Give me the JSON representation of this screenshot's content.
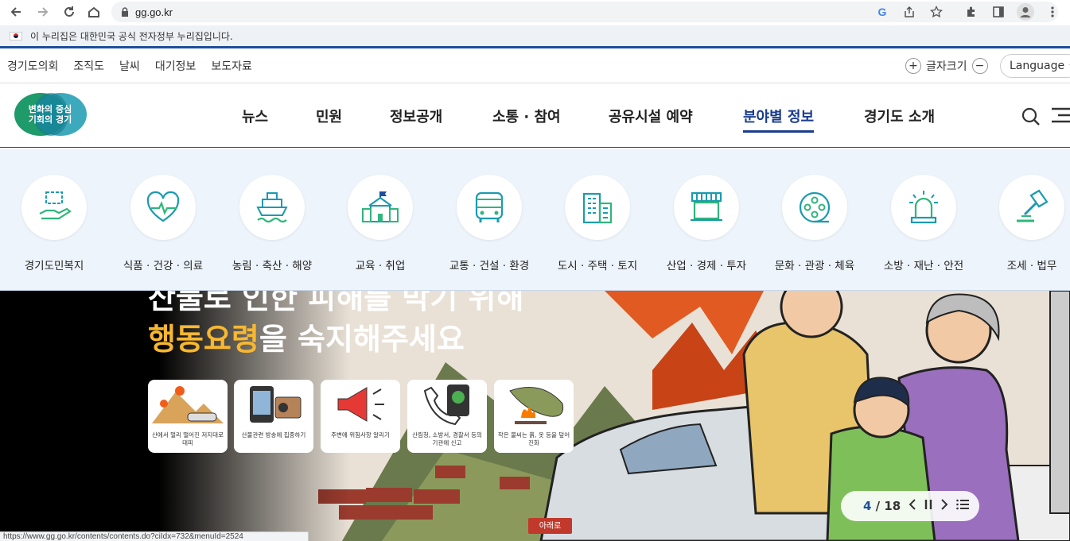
{
  "browser": {
    "url": "gg.go.kr",
    "icons": [
      "back-icon",
      "forward-icon",
      "reload-icon",
      "home-icon",
      "lock-icon",
      "google-icon",
      "share-icon",
      "star-icon",
      "extension-icon",
      "sidebar-icon",
      "profile-icon",
      "more-icon"
    ]
  },
  "gov_banner": {
    "text": "이 누리집은 대한민국 공식 전자정부 누리집입니다."
  },
  "util": {
    "links": [
      "경기도의회",
      "조직도",
      "날씨",
      "대기정보",
      "보도자료"
    ],
    "font_size_label": "글자크기",
    "plus": "+",
    "minus": "−",
    "language": "Language"
  },
  "header": {
    "logo_line1": "변화의 중심",
    "logo_line2": "기회의 경기",
    "gnb": [
      "뉴스",
      "민원",
      "정보공개",
      "소통 · 참여",
      "공유시설 예약",
      "분야별 정보",
      "경기도 소개"
    ],
    "active_index": 5
  },
  "categories": [
    {
      "label": "경기도민복지",
      "icon": "welfare-icon"
    },
    {
      "label": "식품 · 건강 · 의료",
      "icon": "health-icon"
    },
    {
      "label": "농림 · 축산 · 해양",
      "icon": "ship-icon"
    },
    {
      "label": "교육 · 취업",
      "icon": "school-icon"
    },
    {
      "label": "교통 · 건설 · 환경",
      "icon": "bus-icon"
    },
    {
      "label": "도시 · 주택 · 토지",
      "icon": "building-icon"
    },
    {
      "label": "산업 · 경제 · 투자",
      "icon": "store-icon"
    },
    {
      "label": "문화 · 관광 · 체육",
      "icon": "film-icon"
    },
    {
      "label": "소방 · 재난 · 안전",
      "icon": "siren-icon"
    },
    {
      "label": "조세 · 법무",
      "icon": "gavel-icon"
    }
  ],
  "hero": {
    "title_line1": "산불로 인한 피해를 막기 위해",
    "title_highlight": "행동요령",
    "title_rest": "을 숙지해주세요",
    "cards": [
      "산에서 멀리 떨어진 저지대로 대피",
      "산불관련 방송에 집중하기",
      "주변에 위험사항 알리기",
      "산림청, 소방서, 경찰서 등의 기관에 신고",
      "작은 불씨는 흙, 옷 등을 덮어 진화"
    ],
    "sign_text": "아래로",
    "slide_current": "4",
    "slide_total": "18"
  },
  "status_url": "https://www.gg.go.kr/contents/contents.do?ciIdx=732&menuId=2524",
  "colors": {
    "brand_blue": "#1a4f9c",
    "highlight": "#f7b731",
    "icon_green": "#2fb67c",
    "icon_teal": "#1a9bb0"
  }
}
